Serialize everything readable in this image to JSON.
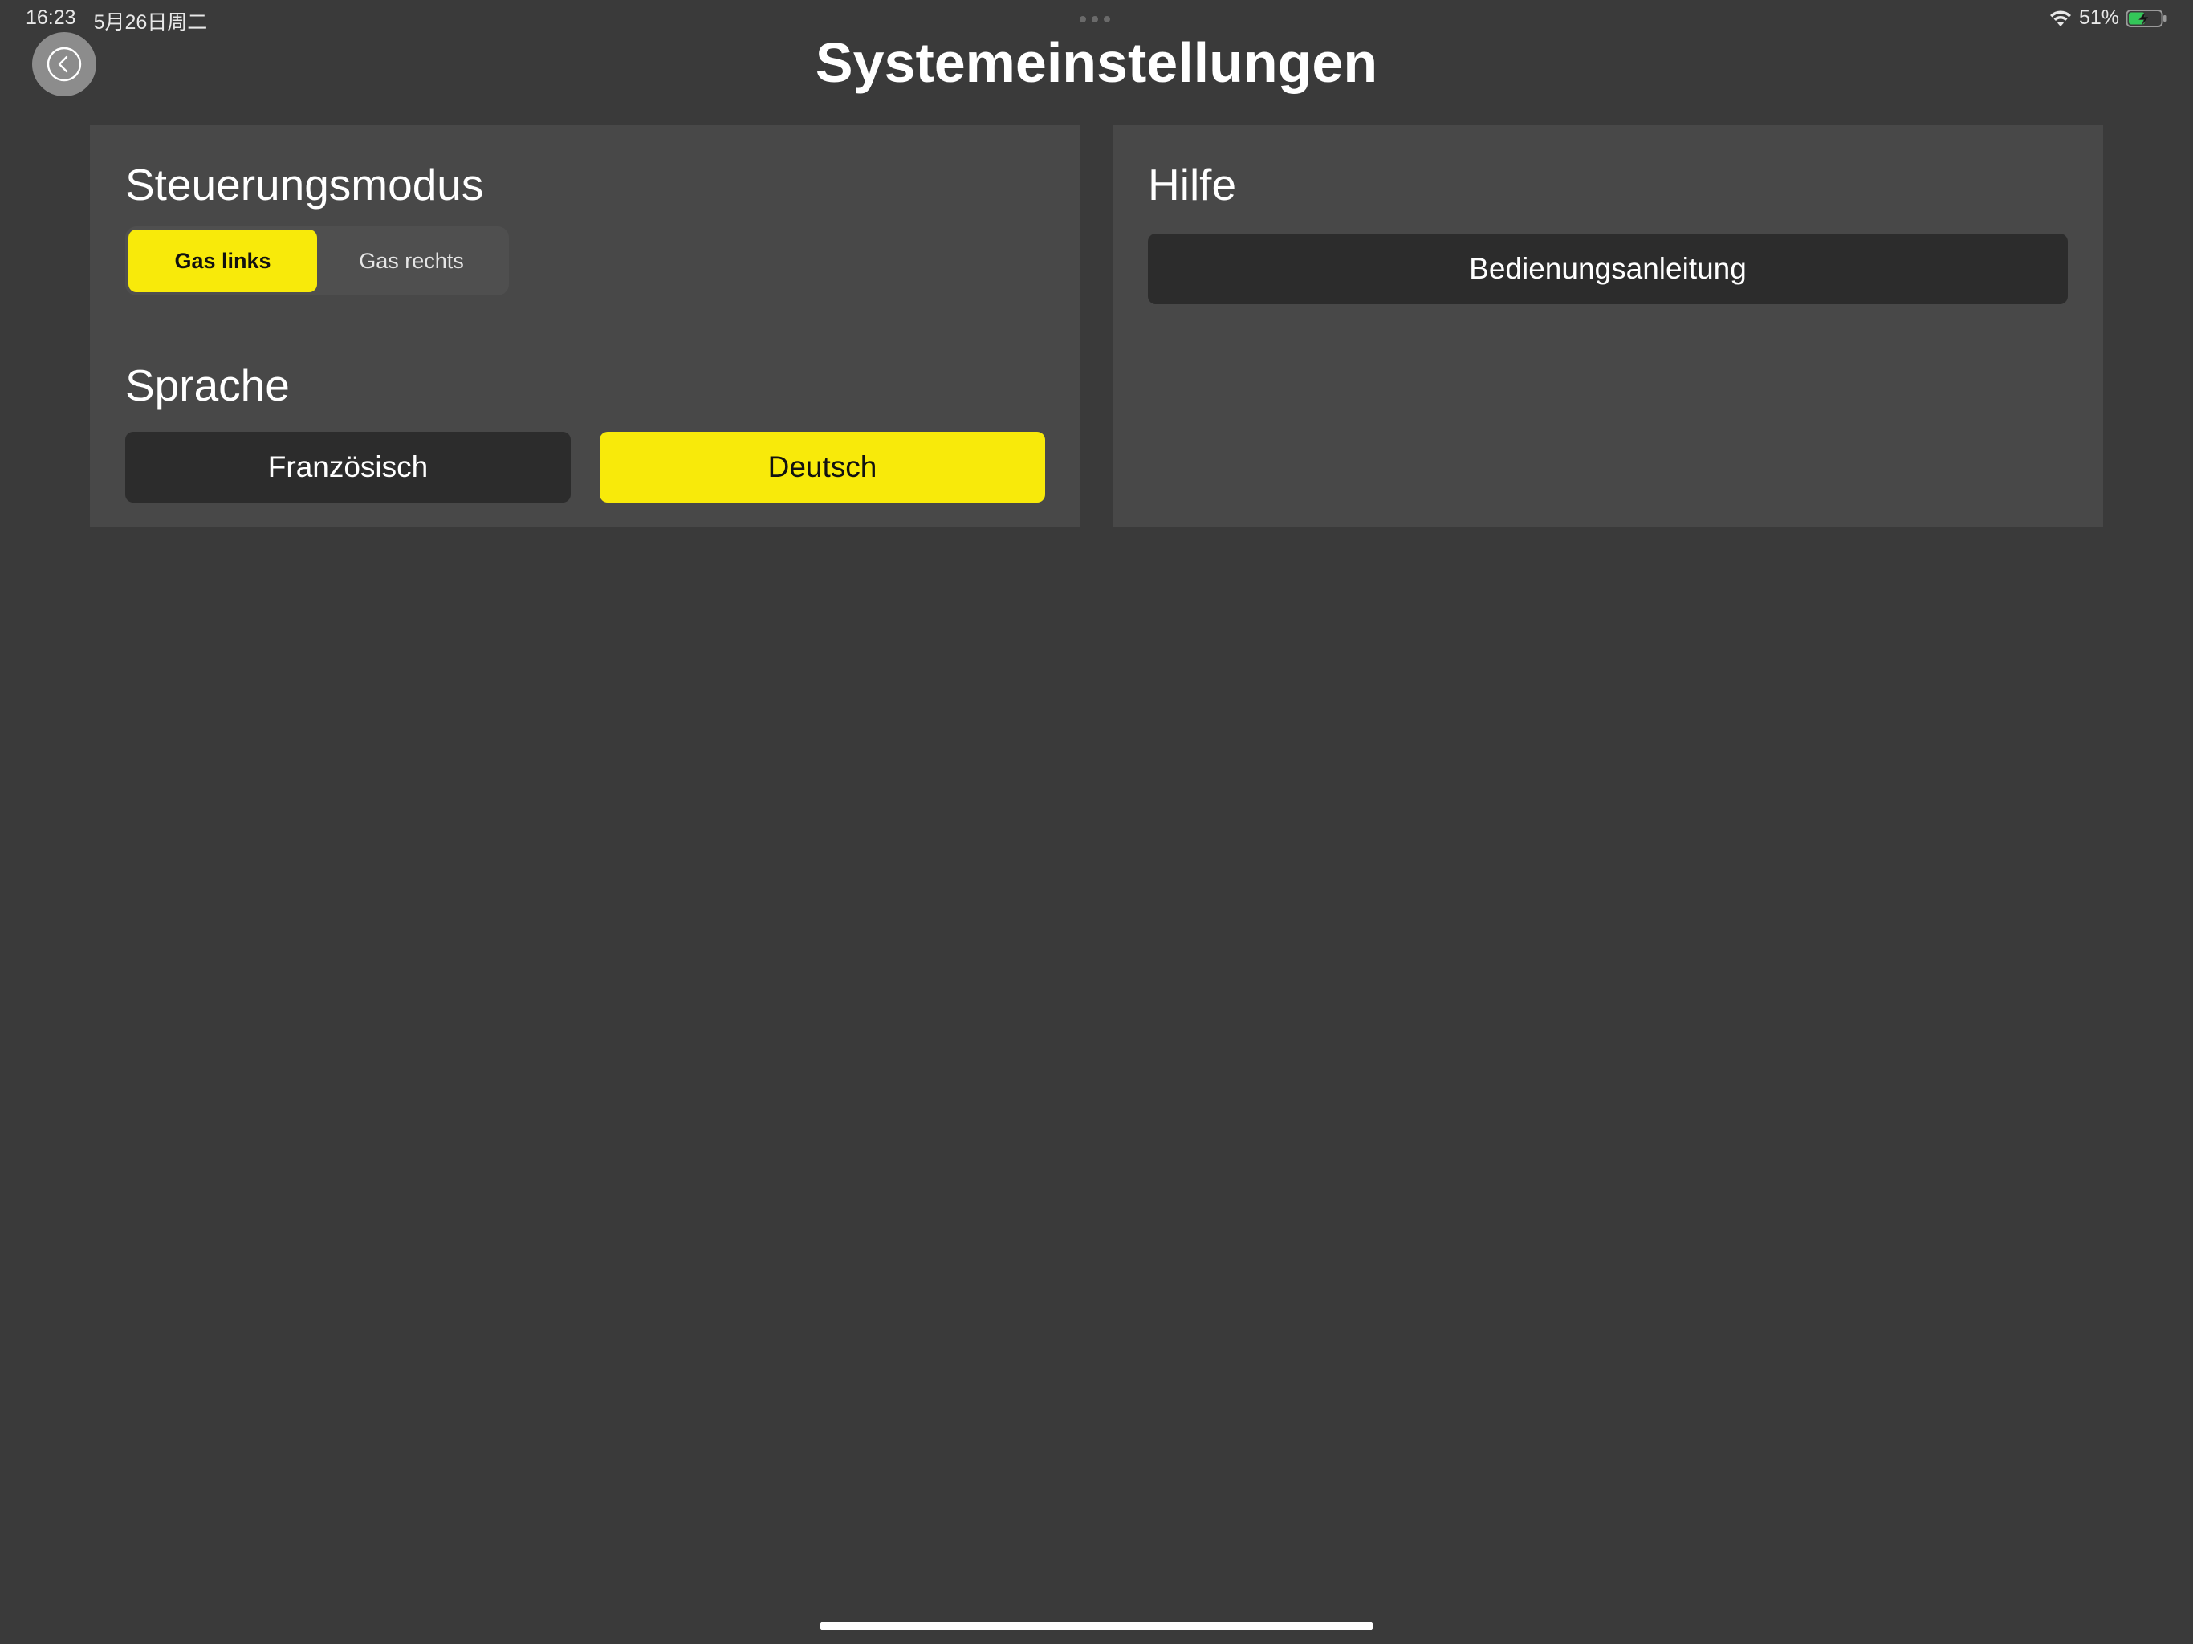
{
  "status_bar": {
    "time": "16:23",
    "date": "5月26日周二",
    "battery_percent": "51%",
    "battery_level": 0.51,
    "battery_charging": true,
    "wifi_icon": "wifi-icon",
    "battery_icon": "battery-charging-icon"
  },
  "header": {
    "title": "Systemeinstellungen",
    "back_icon": "chevron-left-circle-icon"
  },
  "control_mode": {
    "heading": "Steuerungsmodus",
    "options": [
      {
        "label": "Gas links",
        "selected": true
      },
      {
        "label": "Gas rechts",
        "selected": false
      }
    ]
  },
  "language": {
    "heading": "Sprache",
    "options": [
      {
        "label": "Französisch",
        "selected": false
      },
      {
        "label": "Deutsch",
        "selected": true
      }
    ]
  },
  "help": {
    "heading": "Hilfe",
    "manual_button": "Bedienungsanleitung"
  },
  "colors": {
    "background": "#3a3a3a",
    "panel": "#484848",
    "accent_yellow": "#f8ea0a",
    "button_dark": "#2c2c2c",
    "battery_green": "#34c759"
  }
}
